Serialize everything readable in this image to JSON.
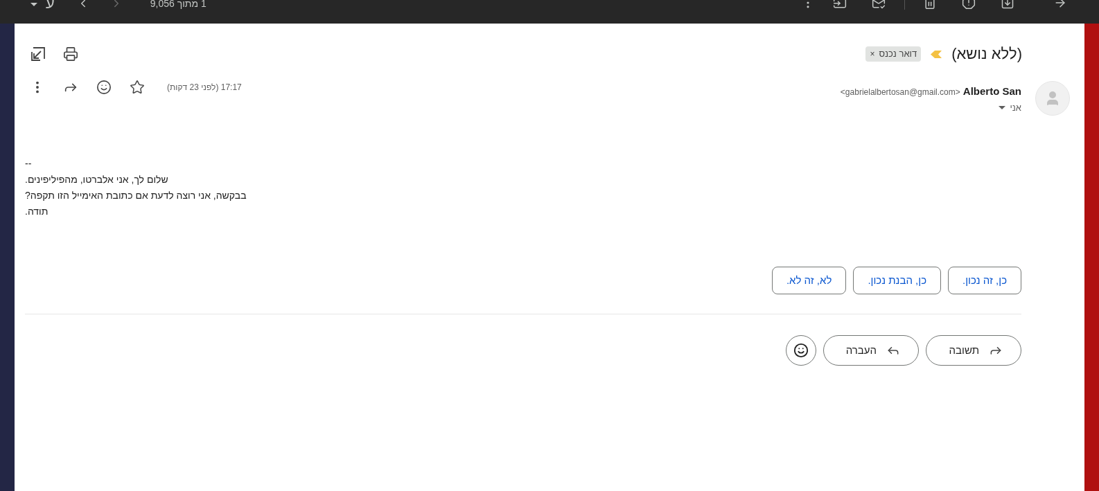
{
  "top_bar": {
    "input_tool": "ע",
    "counter": "1 מתוך 9,056"
  },
  "subject": "(ללא נושא)",
  "important": true,
  "label": {
    "text": "דואר נכנס",
    "remove": "×"
  },
  "sender": {
    "name": "Alberto San",
    "email": "<gabrielalbertosan@gmail.com>",
    "to": "אני"
  },
  "time": "17:17 (לפני 23 דקות)",
  "starred": false,
  "body": [
    "--",
    "שלום לך, אני אלברטו, מהפיליפינים.",
    "בבקשה, אני רוצה לדעת אם כתובת האימייל הזו תקפה?",
    "תודה."
  ],
  "smart_replies": [
    "כן, זה נכון.",
    "כן, הבנת נכון.",
    "לא, זה לא."
  ],
  "actions": [
    {
      "kind": "reply",
      "label": "תשובה"
    },
    {
      "kind": "forward",
      "label": "העברה"
    }
  ]
}
